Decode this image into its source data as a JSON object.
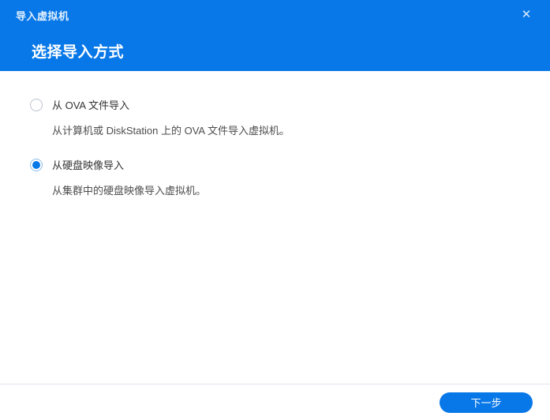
{
  "dialog": {
    "window_title": "导入虚拟机",
    "close_icon": "✕",
    "step_title": "选择导入方式",
    "accent_color": "#0878e8",
    "options": [
      {
        "label": "从 OVA 文件导入",
        "description": "从计算机或 DiskStation 上的 OVA 文件导入虚拟机。",
        "selected": false
      },
      {
        "label": "从硬盘映像导入",
        "description": "从集群中的硬盘映像导入虚拟机。",
        "selected": true
      }
    ],
    "footer": {
      "next_label": "下一步"
    }
  }
}
